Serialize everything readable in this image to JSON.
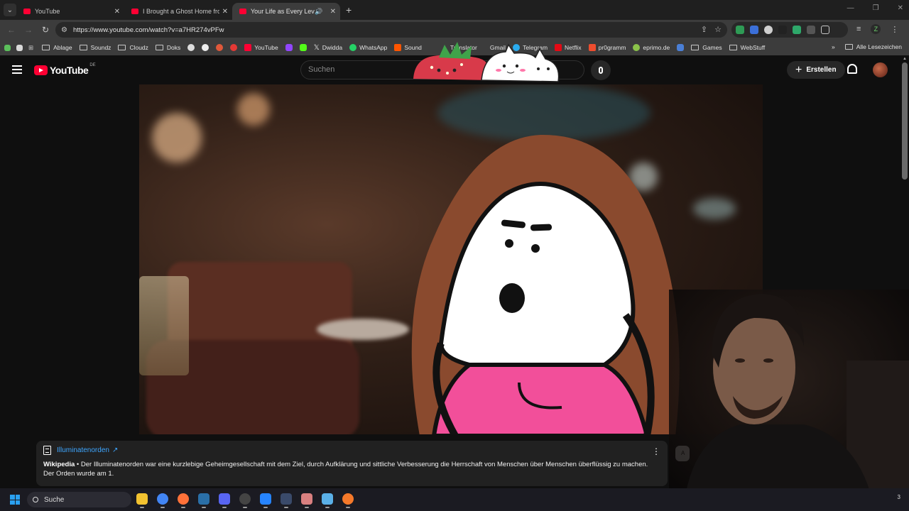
{
  "browser": {
    "tabs": [
      {
        "title": "YouTube",
        "active": false
      },
      {
        "title": "I Brought a Ghost Home from V",
        "active": false
      },
      {
        "title": "Your Life as Every Level Of",
        "active": true
      }
    ],
    "new_tab_symbol": "+",
    "url": "https://www.youtube.com/watch?v=a7HR274vPFw",
    "profile_letter": "Z"
  },
  "bookmarks": {
    "items": [
      {
        "label": "Ablage",
        "type": "folder"
      },
      {
        "label": "Soundz",
        "type": "folder"
      },
      {
        "label": "Cloudz",
        "type": "folder"
      },
      {
        "label": "Doks",
        "type": "folder"
      },
      {
        "label": "YouTube",
        "type": "site",
        "color": "#ff0033"
      },
      {
        "label": "Dwidda",
        "type": "site",
        "color": "#ffffff"
      },
      {
        "label": "WhatsApp",
        "type": "site",
        "color": "#25d366"
      },
      {
        "label": "Sound",
        "type": "site",
        "color": "#ff5500"
      },
      {
        "label": "Translator",
        "type": "site",
        "color": "#3b82f6"
      },
      {
        "label": "Gmail",
        "type": "site",
        "color": "#ea4335"
      },
      {
        "label": "Telegram",
        "type": "site",
        "color": "#2aabee"
      },
      {
        "label": "Netflix",
        "type": "site",
        "color": "#e50914"
      },
      {
        "label": "pr0gramm",
        "type": "site",
        "color": "#ee4d2e"
      },
      {
        "label": "eprimo.de",
        "type": "site",
        "color": "#8bc34a"
      },
      {
        "label": "Games",
        "type": "folder"
      },
      {
        "label": "WebStuff",
        "type": "folder"
      }
    ],
    "overflow_symbol": "»",
    "all_bookmarks": "Alle Lesezeichen"
  },
  "youtube": {
    "logo_text": "YouTube",
    "country_code": "DE",
    "search_placeholder": "Suchen",
    "create_label": "Erstellen",
    "create_symbol": "+"
  },
  "info_panel": {
    "title": "Illuminatenorden",
    "external_symbol": "↗",
    "source": "Wikipedia",
    "text": " • Der Illuminatenorden war eine kurzlebige Geheimgesellschaft mit dem Ziel, durch Aufklärung und sittliche Verbesserung die Herrschaft von Menschen über Menschen überflüssig zu machen. Der Orden wurde am 1.",
    "menu_symbol": "⋮",
    "clipped_button_text": "A"
  },
  "taskbar": {
    "search_label": "Suche",
    "tray_text": "3",
    "apps": [
      {
        "icon": "file-explorer-icon",
        "color": "#f2c230"
      },
      {
        "icon": "chrome-icon",
        "color": "#4285f4"
      },
      {
        "icon": "firefox-icon",
        "color": "#ff7139"
      },
      {
        "icon": "steam-icon",
        "color": "#2a6fa8"
      },
      {
        "icon": "discord-icon",
        "color": "#5865f2"
      },
      {
        "icon": "obs-icon",
        "color": "#444444"
      },
      {
        "icon": "sourcetree-icon",
        "color": "#2684ff"
      },
      {
        "icon": "audio-editor-icon",
        "color": "#3a4a6a"
      },
      {
        "icon": "image-viewer-icon",
        "color": "#d98080"
      },
      {
        "icon": "notepad-icon",
        "color": "#5ab0e8"
      },
      {
        "icon": "blender-icon",
        "color": "#f5792a"
      }
    ]
  },
  "colors": {
    "accent_link": "#3ea6ff",
    "yt_red": "#ff0033"
  }
}
